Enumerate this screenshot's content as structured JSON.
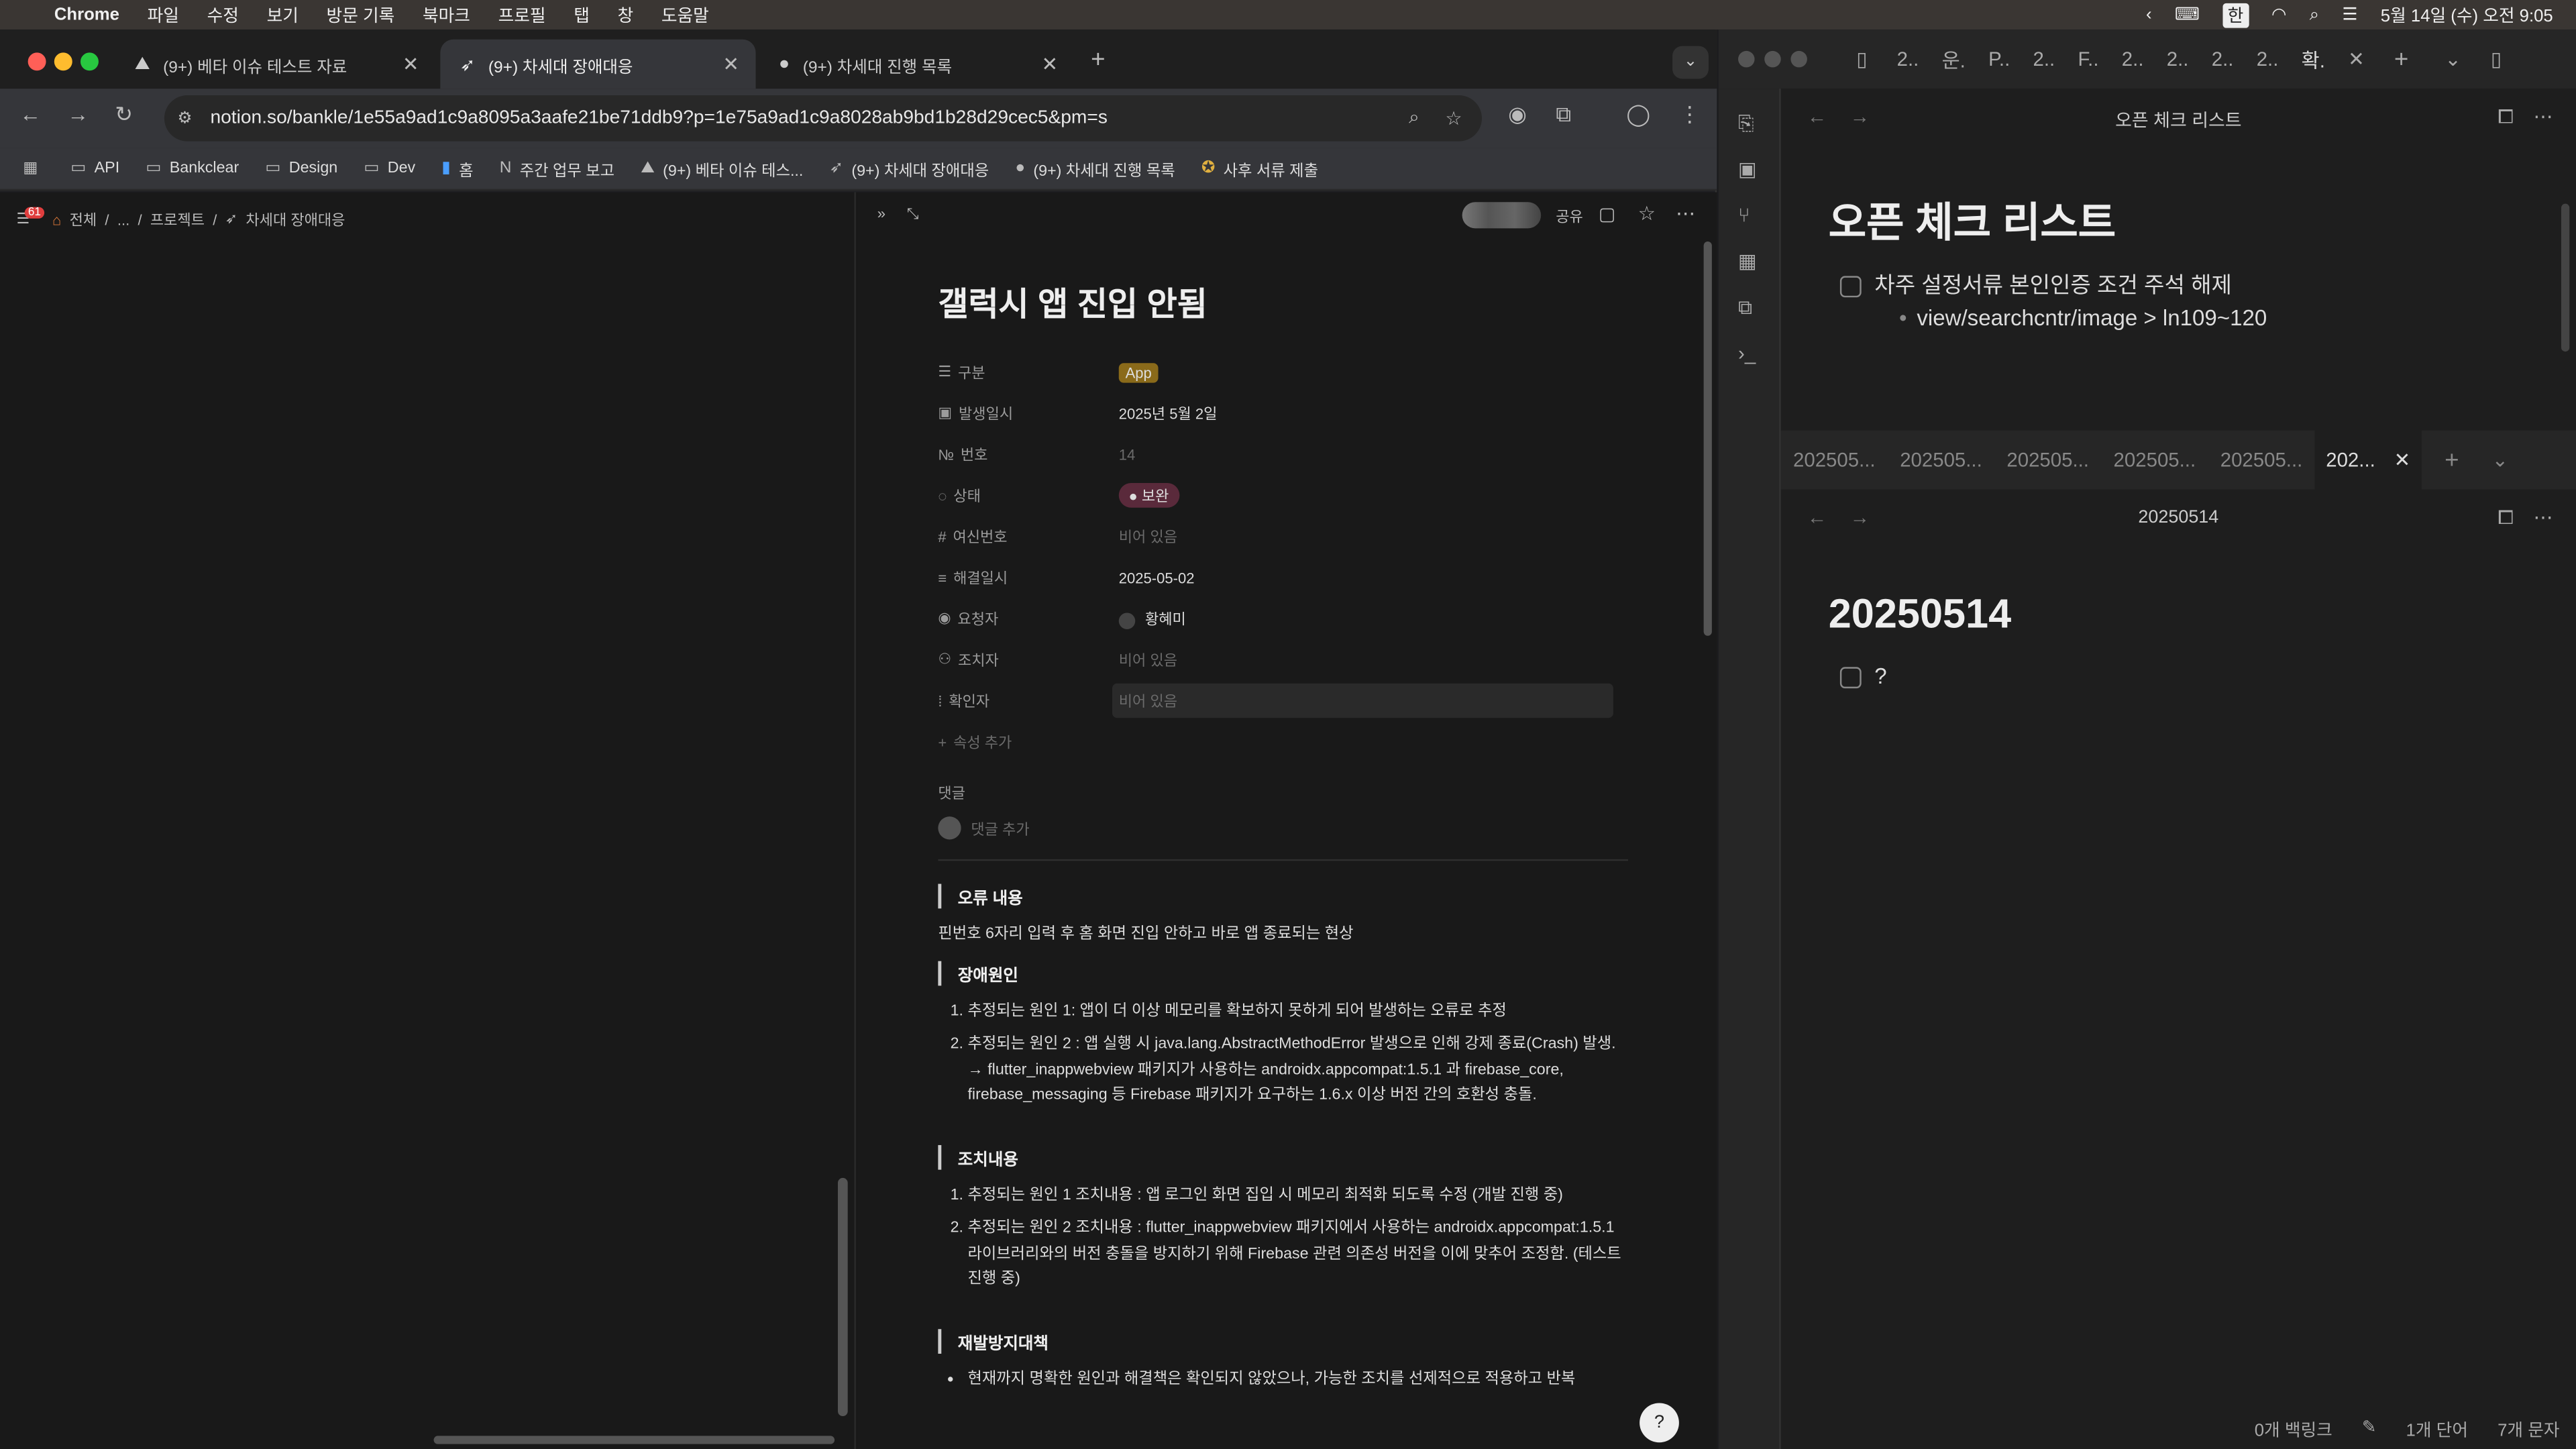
{
  "menubar": {
    "app": "Chrome",
    "items": [
      "파일",
      "수정",
      "보기",
      "방문 기록",
      "북마크",
      "프로필",
      "탭",
      "창",
      "도움말"
    ],
    "ime": "한",
    "datetime": "5월 14일 (수) 오전 9:05"
  },
  "tabs": [
    {
      "label": "(9+) 베타 이슈 테스트 자료"
    },
    {
      "label": "(9+) 차세대 장애대응"
    },
    {
      "label": "(9+) 차세대 진행 목록"
    }
  ],
  "url": "notion.so/bankle/1e55a9ad1c9a8095a3aafe21be71ddb9?p=1e75a9ad1c9a8028ab9bd1b28d29cec5&pm=s",
  "bookmarks": [
    "API",
    "Bankclear",
    "Design",
    "Dev",
    "홈",
    "주간 업무 보고",
    "(9+) 베타 이슈 테스...",
    "(9+) 차세대 장애대응",
    "(9+) 차세대 진행 목록",
    "사후 서류 제출"
  ],
  "breadcrumb": {
    "badge": "61",
    "items": [
      "전체",
      "...",
      "프로젝트",
      "차세대 장애대응"
    ]
  },
  "page": {
    "title": "갤럭시 앱 진입 안됨",
    "share": "공유",
    "props": [
      {
        "k": "구분",
        "v": "App"
      },
      {
        "k": "발생일시",
        "v": "2025년 5월 2일"
      },
      {
        "k": "번호",
        "v": "14"
      },
      {
        "k": "상태",
        "v": "보완"
      },
      {
        "k": "여신번호",
        "v": "비어 있음"
      },
      {
        "k": "해결일시",
        "v": "2025-05-02"
      },
      {
        "k": "요청자",
        "v": "황혜미"
      },
      {
        "k": "조치자",
        "v": "비어 있음"
      },
      {
        "k": "확인자",
        "v": "비어 있음"
      }
    ],
    "add_prop": "속성 추가",
    "comments": "댓글",
    "add_comment": "댓글 추가",
    "sec1": "오류 내용",
    "sec1_text": "핀번호 6자리 입력 후 홈 화면 진입 안하고 바로 앱 종료되는 현상",
    "sec2": "장애원인",
    "sec2_items": [
      "추정되는 원인 1: 앱이 더 이상 메모리를 확보하지 못하게 되어 발생하는 오류로 추정",
      "추정되는 원인 2 :  앱 실행 시 java.lang.AbstractMethodError 발생으로 인해 강제 종료(Crash) 발생. → flutter_inappwebview 패키지가 사용하는 androidx.appcompat:1.5.1 과 firebase_core, firebase_messaging 등 Firebase 패키지가 요구하는 1.6.x 이상 버전 간의 호환성 충돌."
    ],
    "sec3": "조치내용",
    "sec3_items": [
      "추정되는 원인 1 조치내용 : 앱 로그인 화면 집입 시 메모리 최적화 되도록 수정 (개발 진행 중)",
      "추정되는 원인 2 조치내용 : flutter_inappwebview 패키지에서 사용하는 androidx.appcompat:1.5.1 라이브러리와의 버전 충돌을 방지하기 위해 Firebase 관련 의존성 버전을 이에 맞추어 조정함. (테스트 진행 중)"
    ],
    "sec4": "재발방지대책",
    "sec4_text": "현재까지 명확한 원인과 해결책은 확인되지 않았으나, 가능한 조치를 선제적으로 적용하고 반복"
  },
  "obsidian": {
    "tabs": [
      "2..",
      "운.",
      "P..",
      "2..",
      "F..",
      "2..",
      "2..",
      "2..",
      "2..",
      "확."
    ],
    "pane1_title_bar": "오픈 체크 리스트",
    "pane1_h1": "오픈 체크 리스트",
    "pane1_task": "차주 설정서류 본인인증 조건 주석 해제",
    "pane1_sub": "view/searchcntr/image > ln109~120",
    "subtabs": [
      "202505...",
      "202505...",
      "202505...",
      "202505...",
      "202505...",
      "202..."
    ],
    "pane2_title_bar": "20250514",
    "pane2_h1": "20250514",
    "pane2_task": "?",
    "status": {
      "backlinks": "0개 백링크",
      "words": "1개 단어",
      "chars": "7개 문자"
    }
  }
}
